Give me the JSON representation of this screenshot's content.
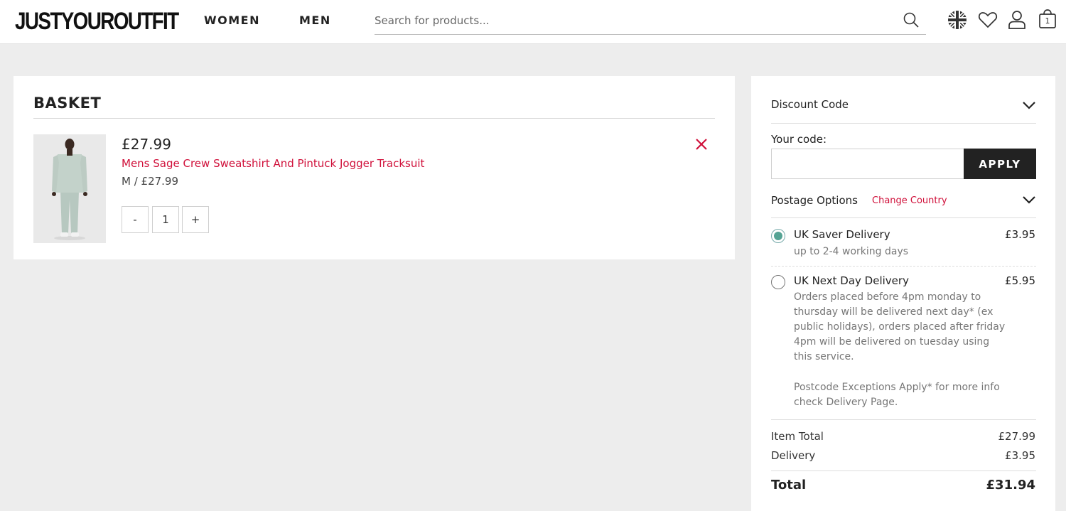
{
  "header": {
    "logo": "JUSTYOUROUTFIT",
    "nav": [
      "WOMEN",
      "MEN"
    ],
    "search_placeholder": "Search for products...",
    "cart_count": "1"
  },
  "basket": {
    "title": "BASKET",
    "items": [
      {
        "price": "£27.99",
        "name": "Mens Sage Crew Sweatshirt And Pintuck Jogger Tracksuit",
        "variant": "M / £27.99",
        "qty": "1",
        "minus": "-",
        "plus": "+"
      }
    ]
  },
  "summary": {
    "discount_label": "Discount Code",
    "code_label": "Your code:",
    "code_value": "",
    "apply_label": "APPLY",
    "postage_label": "Postage Options",
    "change_country": "Change Country",
    "options": [
      {
        "name": "UK Saver Delivery",
        "price": "£3.95",
        "desc": "up to 2-4 working days",
        "selected": true
      },
      {
        "name": "UK Next Day Delivery",
        "price": "£5.95",
        "desc": "Orders placed before 4pm monday to thursday will be delivered next day* (ex public holidays), orders placed after friday 4pm will be delivered on tuesday using this service.",
        "note": "Postcode Exceptions Apply* for more info check Delivery Page.",
        "selected": false
      }
    ],
    "item_total_label": "Item Total",
    "item_total_value": "£27.99",
    "delivery_label": "Delivery",
    "delivery_value": "£3.95",
    "total_label": "Total",
    "total_value": "£31.94"
  },
  "colors": {
    "accent_red": "#d0103a",
    "radio_green": "#55a394",
    "dark_button": "#222222",
    "page_bg": "#ededed"
  }
}
